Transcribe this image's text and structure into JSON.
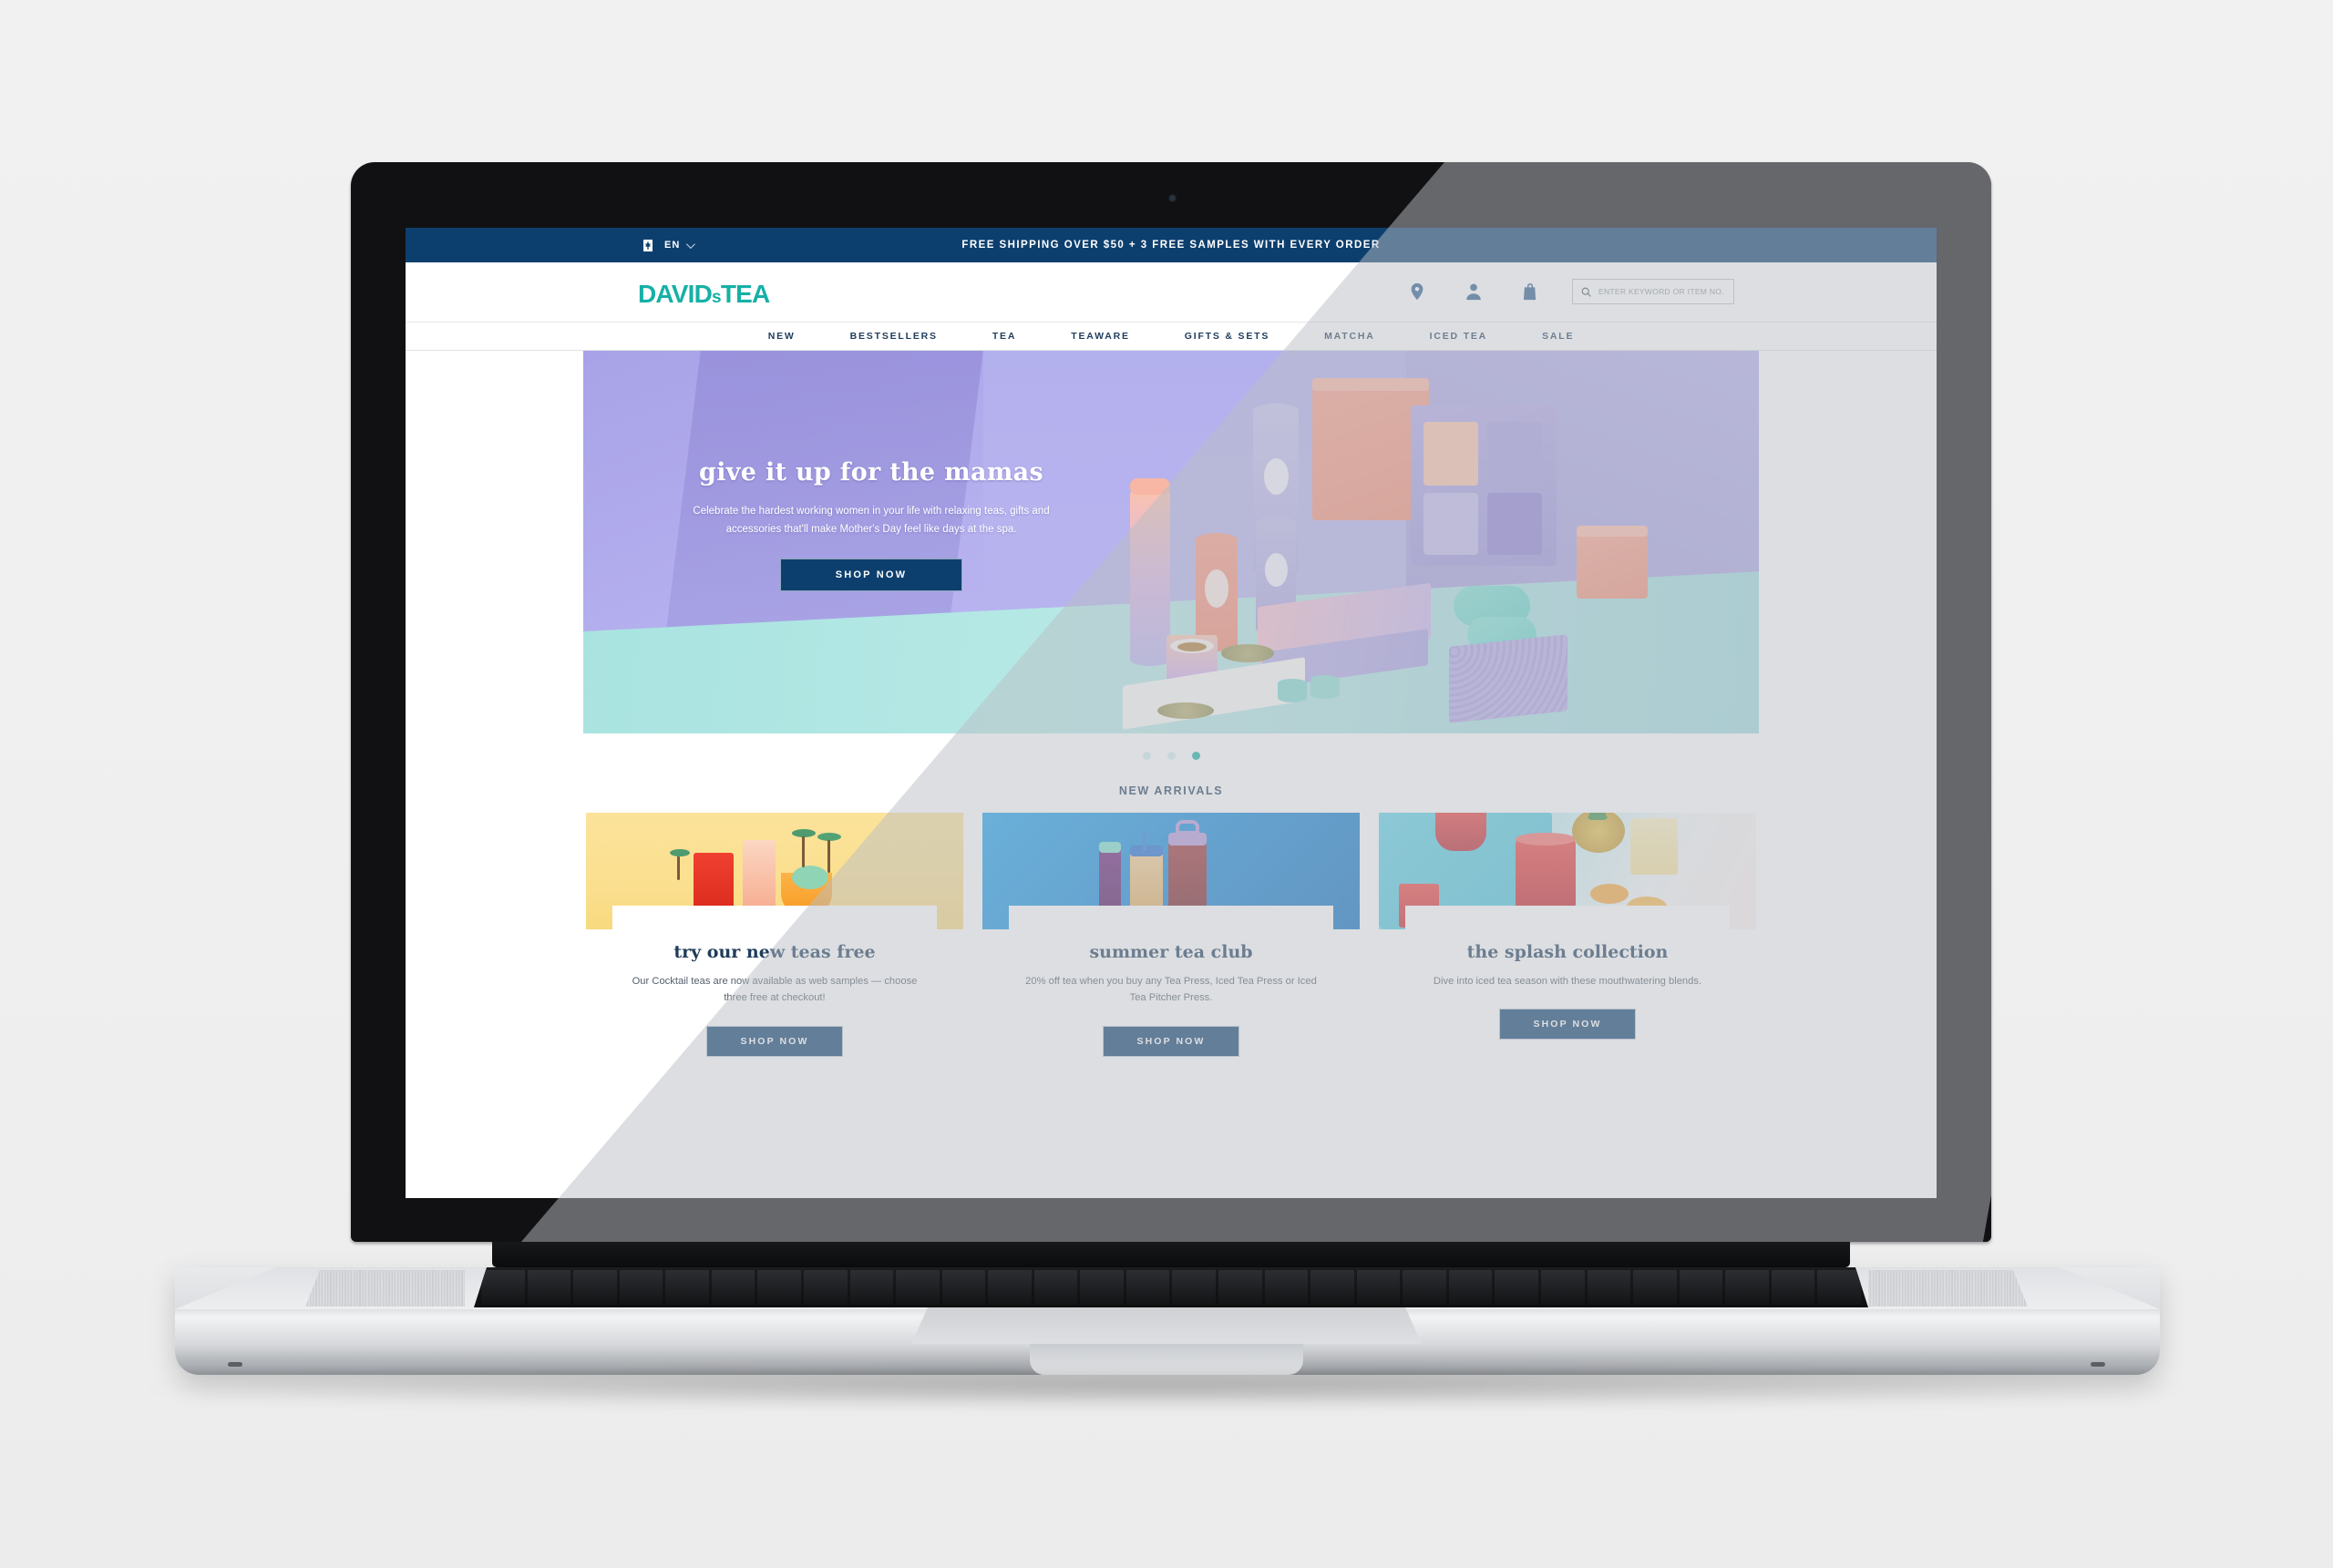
{
  "site": {
    "topbar": {
      "lang_label": "EN",
      "flag_icon": "canada-flag-icon",
      "chevron_icon": "chevron-down-icon",
      "promo_message": "FREE SHIPPING OVER $50 + 3 FREE SAMPLES WITH EVERY ORDER"
    },
    "header": {
      "logo_main": "DAVID",
      "logo_small": "s",
      "logo_end": "TEA",
      "logo_color": "#16b0a6",
      "icons": [
        {
          "name": "store-locator-icon",
          "label": "location-pin"
        },
        {
          "name": "account-icon",
          "label": "user"
        },
        {
          "name": "cart-icon",
          "label": "shopping-bag"
        }
      ],
      "search": {
        "icon": "search-icon",
        "placeholder": "ENTER KEYWORD OR ITEM NO.",
        "value": ""
      }
    },
    "nav": {
      "items": [
        {
          "label": "NEW"
        },
        {
          "label": "BESTSELLERS"
        },
        {
          "label": "TEA"
        },
        {
          "label": "TEAWARE"
        },
        {
          "label": "GIFTS & SETS"
        },
        {
          "label": "MATCHA"
        },
        {
          "label": "ICED TEA"
        },
        {
          "label": "SALE"
        }
      ]
    },
    "hero": {
      "headline": "give it up for the mamas",
      "body": "Celebrate the hardest working women in your life with relaxing teas, gifts and accessories that'll make Mother's Day feel like days at the spa.",
      "cta_label": "SHOP NOW",
      "carousel": {
        "total": 3,
        "active_index": 2
      }
    },
    "new_arrivals": {
      "title": "NEW ARRIVALS",
      "cards": [
        {
          "heading": "try our new teas free",
          "body": "Our Cocktail teas are now available as web samples — choose three free at checkout!",
          "cta_label": "SHOP NOW"
        },
        {
          "heading": "summer tea club",
          "body": "20% off tea when you buy any Tea Press, Iced Tea Press or Iced Tea Pitcher Press.",
          "cta_label": "SHOP NOW"
        },
        {
          "heading": "the splash collection",
          "body": "Dive into iced tea season with these mouthwatering blends.",
          "cta_label": "SHOP NOW"
        }
      ]
    },
    "colors": {
      "brand_teal": "#16b0a6",
      "navy": "#0d3f6e",
      "dark_navy_text": "#1f3c5c",
      "topbar_bg": "#0d3f6e"
    }
  }
}
